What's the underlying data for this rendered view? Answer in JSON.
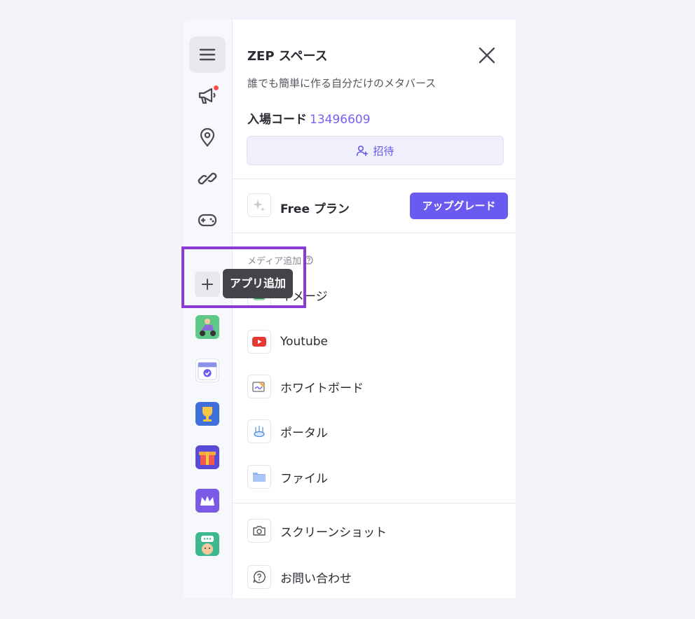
{
  "header": {
    "title": "ZEP スペース",
    "subtitle": "誰でも簡単に作る自分だけのメタバース",
    "code_label": "入場コード",
    "code_value": "13496609",
    "invite_label": "招待"
  },
  "plan": {
    "label": "Free プラン",
    "upgrade_label": "アップグレード"
  },
  "media": {
    "section_label": "メディア追加",
    "items": [
      {
        "label": "イメージ",
        "icon": "image-icon"
      },
      {
        "label": "Youtube",
        "icon": "youtube-icon"
      },
      {
        "label": "ホワイトボード",
        "icon": "whiteboard-icon"
      },
      {
        "label": "ポータル",
        "icon": "portal-icon"
      },
      {
        "label": "ファイル",
        "icon": "folder-icon"
      }
    ]
  },
  "tools": {
    "items": [
      {
        "label": "スクリーンショット",
        "icon": "camera-icon"
      },
      {
        "label": "お問い合わせ",
        "icon": "help-icon"
      }
    ]
  },
  "sidebar": {
    "tooltip": "アプリ追加",
    "icons": [
      "menu-icon",
      "megaphone-icon",
      "location-pin-icon",
      "link-icon",
      "gamepad-icon"
    ],
    "apps": [
      "scooter-app",
      "calendar-app",
      "trophy-app",
      "gift-app",
      "crown-app",
      "chat-character-app"
    ]
  },
  "colors": {
    "accent": "#6a5af0",
    "code": "#7561f0",
    "highlight": "#8a3ad6"
  }
}
